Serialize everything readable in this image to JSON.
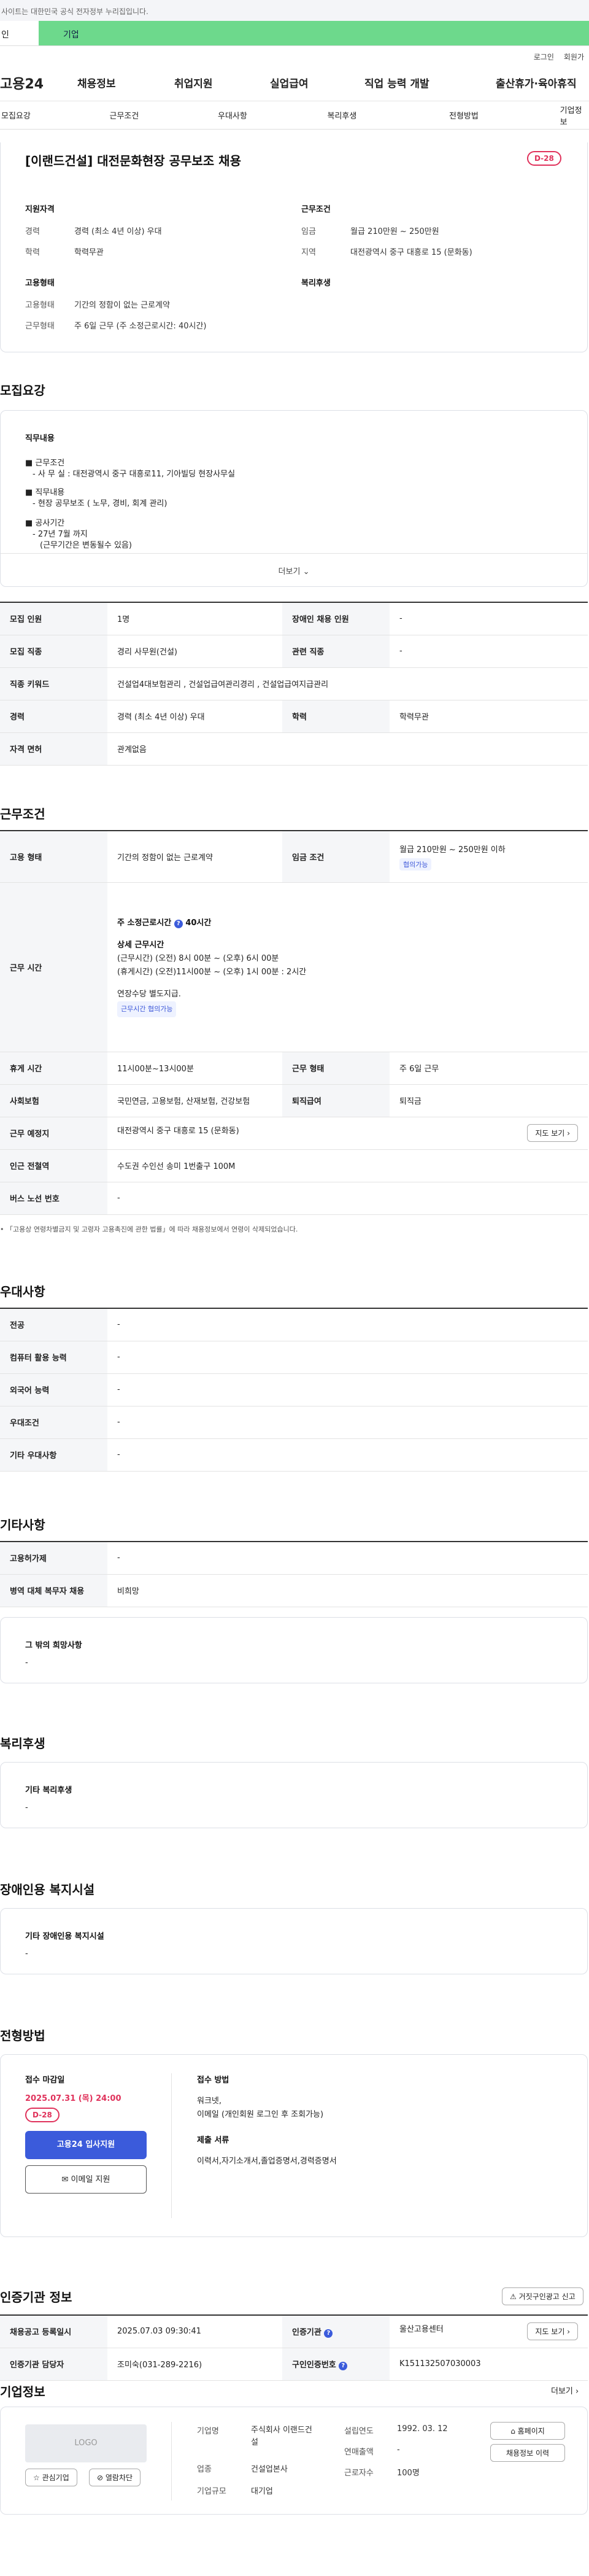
{
  "topbar": {
    "notice": "사이트는 대한민국 공식 전자정부 누리집입니다."
  },
  "tabs": {
    "personal": "인",
    "company": "기업"
  },
  "util": {
    "login": "로그인",
    "join": "회원가"
  },
  "gnb": {
    "logo": "고용24",
    "menu": [
      "채용정보",
      "취업지원",
      "실업급여",
      "직업 능력 개발",
      "출산휴가·육아휴직"
    ]
  },
  "lnb": [
    "모집요강",
    "근무조건",
    "우대사항",
    "복리후생",
    "전형방법",
    "기업정보"
  ],
  "job": {
    "title": "[이랜드건설] 대전문화현장 공무보조 채용",
    "dday": "D-28",
    "qual_title": "지원자격",
    "qual": [
      {
        "k": "경력",
        "v": "경력 (최소 4년 이상) 우대"
      },
      {
        "k": "학력",
        "v": "학력무관"
      }
    ],
    "cond_title": "근무조건",
    "cond": [
      {
        "k": "임금",
        "v": "월급 210만원 ~ 250만원"
      },
      {
        "k": "지역",
        "v": "대전광역시 중구 대흥로 15 (문화동)"
      }
    ],
    "type_title": "고용형태",
    "type": [
      {
        "k": "고용형태",
        "v": "기간의 정함이 없는 근로계약"
      },
      {
        "k": "근무형태",
        "v": "주 6일 근무 (주 소정근로시간: 40시간)"
      }
    ],
    "welfare_title": "복리후생"
  },
  "recruit": {
    "title": "모집요강",
    "content_title": "직무내용",
    "items": [
      {
        "h": "■ 근무조건",
        "lines": [
          "- 사 무 실 : 대전광역시 중구 대흥로11, 기아빌딩 현장사무실"
        ]
      },
      {
        "h": "■ 직무내용",
        "lines": [
          "- 현장 공무보조 ( 노무, 경비, 회계 관리)"
        ]
      },
      {
        "h": "■ 공사기간",
        "lines": [
          "- 27년 7월 까지",
          "(근무기간은 변동될수 있음)"
        ]
      }
    ],
    "more": "더보기",
    "table": [
      [
        "모집 인원",
        "1명",
        "장애인 채용 인원",
        "-"
      ],
      [
        "모집 직종",
        "경리 사무원(건설)",
        "관련 직종",
        "-"
      ],
      [
        "직종 키워드",
        "건설업4대보험관리 , 건설업급여관리경리 , 건설업급여지급관리"
      ],
      [
        "경력",
        "경력 (최소 4년 이상) 우대",
        "학력",
        "학력무관"
      ],
      [
        "자격 면허",
        "관계없음"
      ]
    ]
  },
  "work": {
    "title": "근무조건",
    "emp_type_k": "고용 형태",
    "emp_type_v": "기간의 정함이 없는 근로계약",
    "wage_k": "임금 조건",
    "wage_v": "월급 210만원 ~ 250만원 이하",
    "wage_tag": "협의가능",
    "time_k": "근무 시간",
    "time_week": "주 소정근로시간",
    "time_week_v": "40시간",
    "time_detail_h": "상세 근무시간",
    "time_detail": [
      "(근무시간) (오전) 8시 00분 ~ (오후) 6시 00분",
      "(휴게시간) (오전)11시00분 ~ (오후) 1시 00분 : 2시간"
    ],
    "time_note": "연장수당 별도지급.",
    "time_tag": "근무시간 협의가능",
    "rows": [
      [
        "휴게 시간",
        "11시00분~13시00분",
        "근무 형태",
        "주 6일 근무"
      ],
      [
        "사회보험",
        "국민연금, 고용보험, 산재보험, 건강보험",
        "퇴직급여",
        "퇴직금"
      ]
    ],
    "place_k": "근무 예정지",
    "place_v": "대전광역시 중구 대흥로 15 (문화동)",
    "map_btn": "지도 보기",
    "subway_k": "인근 전철역",
    "subway_v": "수도권 수인선 송미 1번출구 100M",
    "bus_k": "버스 노선 번호",
    "bus_v": "-",
    "notice": "「고용상 연령차별금지 및 고령자 고용촉진에 관한 법률」에 따라 채용정보에서 연령이 삭제되었습니다."
  },
  "pref": {
    "title": "우대사항",
    "rows": [
      [
        "전공",
        "-"
      ],
      [
        "컴퓨터 활용 능력",
        "-"
      ],
      [
        "외국어 능력",
        "-"
      ],
      [
        "우대조건",
        "-"
      ],
      [
        "기타 우대사항",
        "-"
      ]
    ]
  },
  "etc": {
    "title": "기타사항",
    "rows": [
      [
        "고용허가제",
        "-"
      ],
      [
        "병역 대체 복무자 채용",
        "비희망"
      ]
    ],
    "box_title": "그 밖의 희망사항",
    "box_val": "-"
  },
  "welfare": {
    "title": "복리후생",
    "box_title": "기타 복리후생",
    "box_val": "-"
  },
  "disabled": {
    "title": "장애인용 복지시설",
    "box_title": "기타 장애인용 복지시설",
    "box_val": "-"
  },
  "process": {
    "title": "전형방법",
    "deadline_h": "접수 마감일",
    "deadline": "2025.07.31 (목) 24:00",
    "dday": "D-28",
    "apply_btn": "고용24 입사지원",
    "email_btn": "이메일 지원",
    "method_h": "접수 방법",
    "method": [
      "워크넷,",
      "이메일 (개인회원 로그인 후 조회가능)"
    ],
    "docs_h": "제출 서류",
    "docs": "이력서,자기소개서,졸업증명서,경력증명서"
  },
  "agency": {
    "title": "인증기관 정보",
    "report_btn": "거짓구인광고 신고",
    "rows": [
      [
        "채용공고 등록일시",
        "2025.07.03 09:30:41",
        "인증기관",
        "울산고용센터"
      ],
      [
        "인증기관 담당자",
        "조미숙(031-289-2216)",
        "구인인증번호",
        "K151132507030003"
      ]
    ],
    "map_btn": "지도 보기"
  },
  "company": {
    "title": "기업정보",
    "more": "더보기",
    "logo": "LOGO",
    "fav_btn": "관심기업",
    "block_btn": "열람차단",
    "fields": [
      [
        "기업명",
        "주식회사 이랜드건설"
      ],
      [
        "업종",
        "건설업본사"
      ],
      [
        "기업규모",
        "대기업"
      ]
    ],
    "fields2": [
      [
        "설립연도",
        "1992. 03. 12"
      ],
      [
        "연매출액",
        "-"
      ],
      [
        "근로자수",
        "100명"
      ]
    ],
    "home_btn": "홈페이지",
    "jobs_btn": "채용정보 이력"
  },
  "colors": {
    "accent": "#3b5bdb",
    "dday": "#e0325b",
    "green": "#6dd98c"
  }
}
